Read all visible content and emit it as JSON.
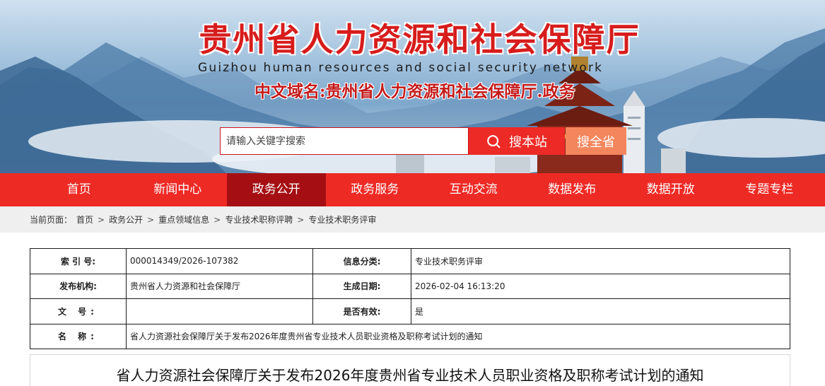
{
  "header": {
    "site_title": "贵州省人力资源和社会保障厅",
    "site_subtitle": "Guizhou human resources and social security network",
    "domain_line": "中文域名:贵州省人力资源和社会保障厅.政务"
  },
  "search": {
    "placeholder": "请输入关键字搜索",
    "site_button": "搜本站",
    "all_button": "搜全省"
  },
  "nav": {
    "items": [
      "首页",
      "新闻中心",
      "政务公开",
      "政务服务",
      "互动交流",
      "数据发布",
      "数据开放",
      "专题专栏"
    ],
    "active": "政务公开"
  },
  "breadcrumb": {
    "prefix": "当前页面：",
    "items": [
      "首页",
      "政务公开",
      "重点领域信息",
      "专业技术职称评聘",
      "专业技术职务评审"
    ]
  },
  "info": {
    "index_label": "索 引 号:",
    "index_value": "000014349/2026-107382",
    "category_label": "信息分类:",
    "category_value": "专业技术职务评审",
    "publisher_label": "发布机构:",
    "publisher_value": "贵州省人力资源和社会保障厅",
    "date_label": "生成日期:",
    "date_value": "2026-02-04 16:13:20",
    "docno_label": "文 号:",
    "docno_value": "",
    "valid_label": "是否有效:",
    "valid_value": "是",
    "name_label": "名 称:",
    "name_value": "省人力资源社会保障厅关于发布2026年度贵州省专业技术人员职业资格及职称考试计划的通知"
  },
  "article": {
    "title": "省人力资源社会保障厅关于发布2026年度贵州省专业技术人员职业资格及职称考试计划的通知"
  },
  "colors": {
    "brand_red": "#ee2a25",
    "nav_active": "#a50f13",
    "search_all_button": "#f4865d"
  }
}
